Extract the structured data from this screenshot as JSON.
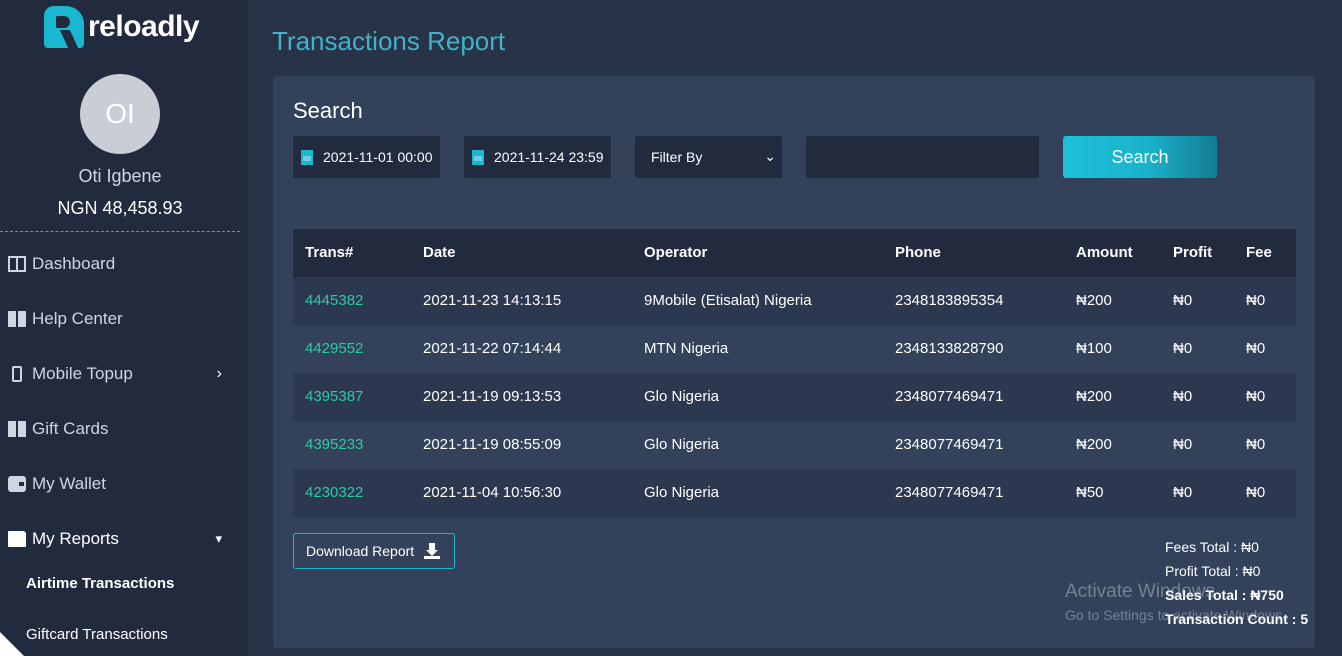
{
  "brand": {
    "name": "reloadly",
    "color": "#1ab8d0"
  },
  "user": {
    "initials": "OI",
    "name": "Oti Igbene",
    "balance": "NGN 48,458.93"
  },
  "sidebar": {
    "items": [
      {
        "label": "Dashboard",
        "icon": "dashboard-icon"
      },
      {
        "label": "Help Center",
        "icon": "book-icon"
      },
      {
        "label": "Mobile Topup",
        "icon": "mobile-icon"
      },
      {
        "label": "Gift Cards",
        "icon": "gift-icon"
      },
      {
        "label": "My Wallet",
        "icon": "wallet-icon"
      },
      {
        "label": "My Reports",
        "icon": "folder-open-icon"
      }
    ],
    "sub_items": [
      {
        "label": "Airtime Transactions"
      },
      {
        "label": "Giftcard Transactions"
      }
    ]
  },
  "page": {
    "title": "Transactions Report"
  },
  "search": {
    "title": "Search",
    "start_date": "2021-11-01  00:00",
    "end_date": "2021-11-24  23:59",
    "filter_label": "Filter By",
    "button_label": "Search"
  },
  "table": {
    "headers": [
      "Trans#",
      "Date",
      "Operator",
      "Phone",
      "Amount",
      "Profit",
      "Fee"
    ],
    "rows": [
      {
        "trans": "4445382",
        "date": "2021-11-23 14:13:15",
        "operator": "9Mobile (Etisalat) Nigeria",
        "phone": "2348183895354",
        "amount": "₦200",
        "profit": "₦0",
        "fee": "₦0"
      },
      {
        "trans": "4429552",
        "date": "2021-11-22 07:14:44",
        "operator": "MTN Nigeria",
        "phone": "2348133828790",
        "amount": "₦100",
        "profit": "₦0",
        "fee": "₦0"
      },
      {
        "trans": "4395387",
        "date": "2021-11-19 09:13:53",
        "operator": "Glo Nigeria",
        "phone": "2348077469471",
        "amount": "₦200",
        "profit": "₦0",
        "fee": "₦0"
      },
      {
        "trans": "4395233",
        "date": "2021-11-19 08:55:09",
        "operator": "Glo Nigeria",
        "phone": "2348077469471",
        "amount": "₦200",
        "profit": "₦0",
        "fee": "₦0"
      },
      {
        "trans": "4230322",
        "date": "2021-11-04 10:56:30",
        "operator": "Glo Nigeria",
        "phone": "2348077469471",
        "amount": "₦50",
        "profit": "₦0",
        "fee": "₦0"
      }
    ]
  },
  "download": {
    "label": "Download Report"
  },
  "totals": {
    "fees": "Fees Total : ₦0",
    "profit": "Profit Total : ₦0",
    "sales": "Sales Total : ₦750",
    "count": "Transaction Count : 5"
  },
  "watermark": {
    "line1": "Activate Windows",
    "line2": "Go to Settings to activate Windows."
  }
}
